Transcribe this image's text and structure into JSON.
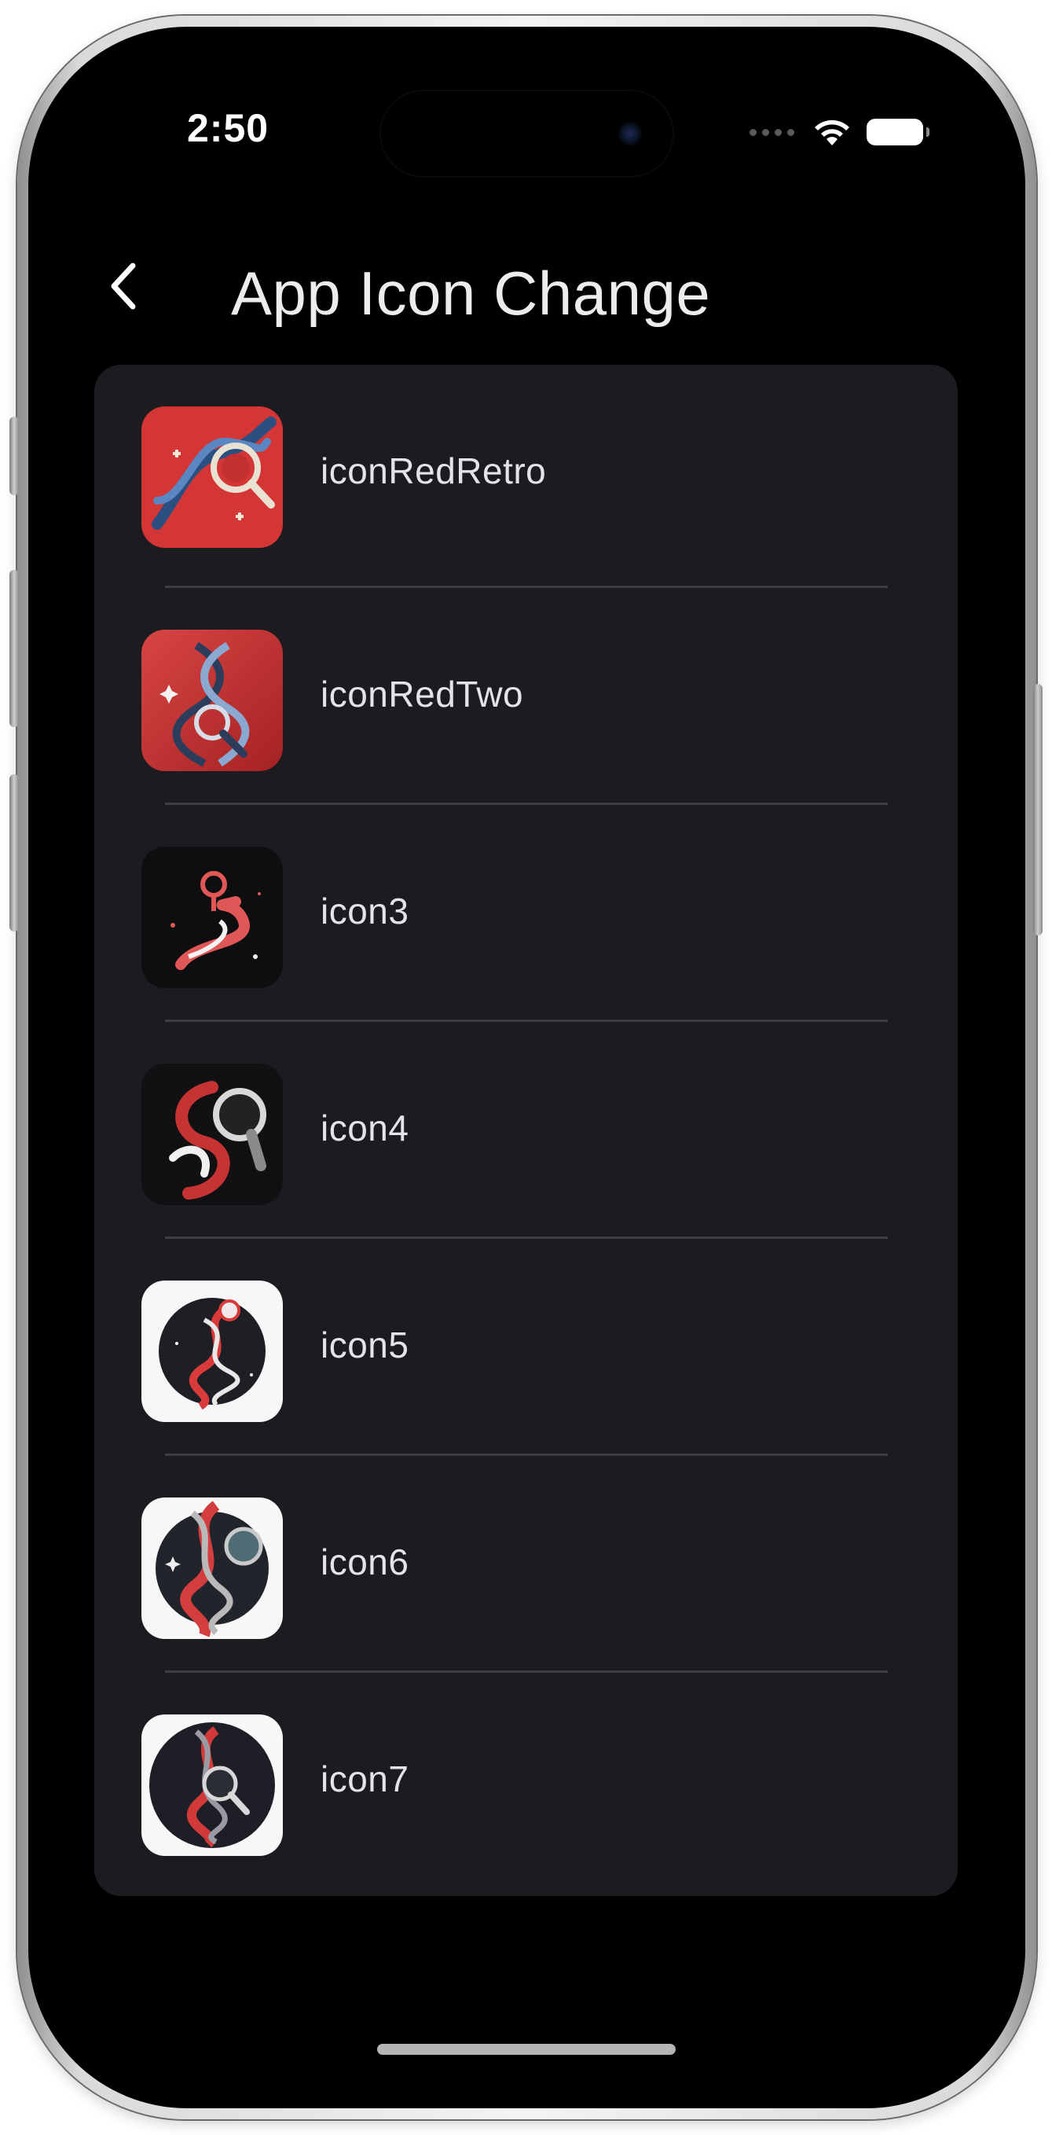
{
  "status_bar": {
    "time": "2:50",
    "icons": [
      "cellular-dots-icon",
      "wifi-icon",
      "battery-icon"
    ]
  },
  "nav": {
    "back_icon": "chevron-left-icon",
    "title": "App Icon Change"
  },
  "icon_list": {
    "items": [
      {
        "label": "iconRedRetro",
        "icon": "dna-magnifier-red-retro-icon"
      },
      {
        "label": "iconRedTwo",
        "icon": "dna-magnifier-red-icon"
      },
      {
        "label": "icon3",
        "icon": "dna-dark-icon"
      },
      {
        "label": "icon4",
        "icon": "dna-magnifier-dark-icon"
      },
      {
        "label": "icon5",
        "icon": "dna-circle-white-icon"
      },
      {
        "label": "icon6",
        "icon": "dna-magnifier-circle-white-icon"
      },
      {
        "label": "icon7",
        "icon": "dna-magnifier-circle-white-icon"
      }
    ]
  },
  "colors": {
    "background": "#000000",
    "card": "#1c1b1f",
    "divider": "#3e3d42",
    "text": "#e4e3e8",
    "accent_red": "#d93a3a"
  }
}
